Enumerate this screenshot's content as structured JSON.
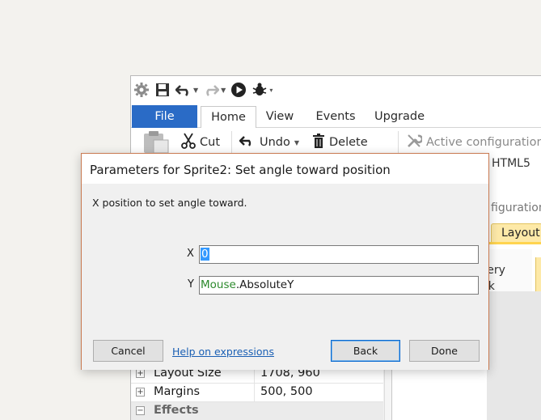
{
  "app": {
    "ribbon_tabs": [
      "File",
      "Home",
      "View",
      "Events",
      "Upgrade"
    ],
    "ribbon": {
      "cut_label": "Cut",
      "undo_label": "Undo",
      "delete_label": "Delete",
      "active_configurations_label": "Active configurations",
      "html5_label": "HTML5",
      "configurations_label": "figurations"
    },
    "layout_tab_label": "Layout",
    "side_text": [
      "very",
      "ck"
    ],
    "properties": [
      {
        "name": "Layout Size",
        "value": "1708, 960",
        "expander": "+"
      },
      {
        "name": "Margins",
        "value": "500, 500",
        "expander": "+"
      },
      {
        "name": "Effects",
        "value": "",
        "expander": "−"
      }
    ],
    "colors": {
      "file_tab": "#2a6bc6",
      "layout_tab": "#fde9a8"
    }
  },
  "dialog": {
    "title": "Parameters for Sprite2: Set angle toward position",
    "description": "X position to set angle toward.",
    "fields": [
      {
        "label": "X",
        "value": "0",
        "value_selected": true
      },
      {
        "label": "Y",
        "object_part": "Mouse",
        "expression_part": ".AbsoluteY"
      }
    ],
    "buttons": {
      "cancel": "Cancel",
      "help_link": "Help on expressions",
      "back": "Back",
      "done": "Done"
    },
    "colors": {
      "border": "#c97a52",
      "selection": "#3399ff",
      "object_name": "#2d8a2d",
      "link": "#1a5fb4"
    }
  }
}
